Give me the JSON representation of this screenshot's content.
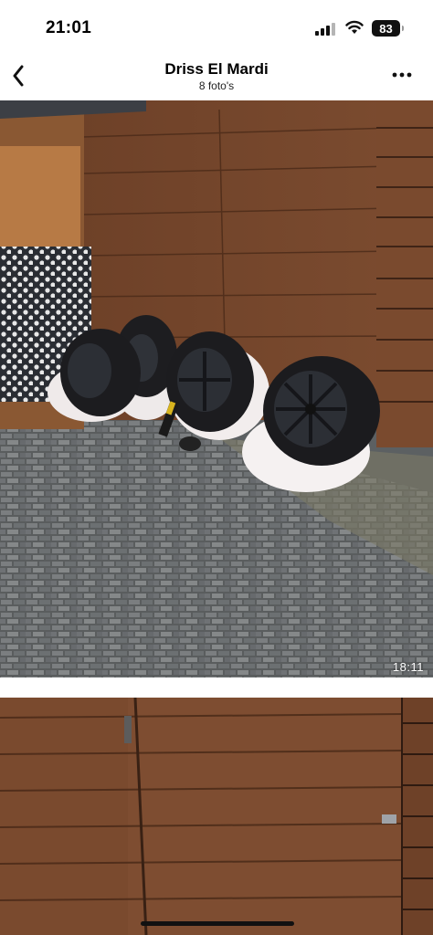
{
  "status": {
    "time": "21:01",
    "battery": "83"
  },
  "header": {
    "title": "Driss El Mardi",
    "subtitle": "8 foto's"
  },
  "photos": [
    {
      "label": "Vier wielen met zwarte velgen tegen houten schuur",
      "duration": "18:11"
    },
    {
      "label": "Houten schuur wand"
    }
  ],
  "icons": {
    "back": "chevron-left-icon",
    "more": "more-dots-icon",
    "signal": "signal-icon",
    "wifi": "wifi-icon",
    "battery": "battery-icon"
  }
}
